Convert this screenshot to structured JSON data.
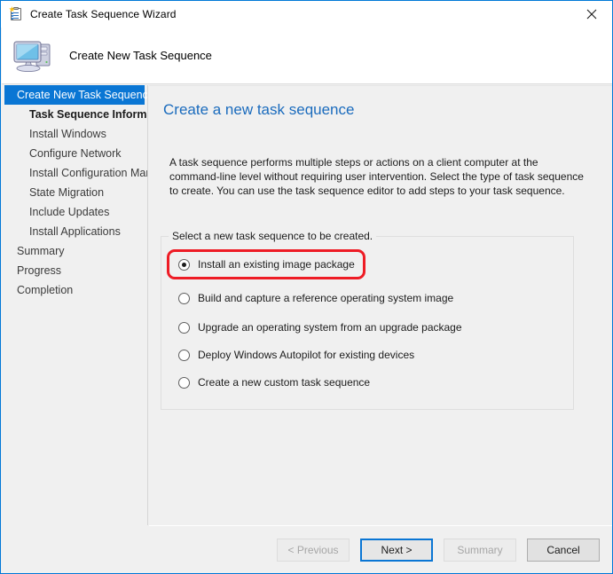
{
  "window": {
    "title": "Create Task Sequence Wizard",
    "title_icon": "task-sequence-clipboard-icon",
    "close_label": "✕",
    "accent_color": "#0078d7"
  },
  "banner": {
    "title": "Create New Task Sequence",
    "icon": "computer-monitor-icon"
  },
  "sidebar": {
    "items": [
      {
        "label": "Create New Task Sequence",
        "level": 0,
        "state": "active"
      },
      {
        "label": "Task Sequence Information",
        "level": 1,
        "state": "current"
      },
      {
        "label": "Install Windows",
        "level": 1,
        "state": "normal"
      },
      {
        "label": "Configure Network",
        "level": 1,
        "state": "normal"
      },
      {
        "label": "Install Configuration Manager",
        "level": 1,
        "state": "normal"
      },
      {
        "label": "State Migration",
        "level": 1,
        "state": "normal"
      },
      {
        "label": "Include Updates",
        "level": 1,
        "state": "normal"
      },
      {
        "label": "Install Applications",
        "level": 1,
        "state": "normal"
      },
      {
        "label": "Summary",
        "level": 0,
        "state": "normal"
      },
      {
        "label": "Progress",
        "level": 0,
        "state": "normal"
      },
      {
        "label": "Completion",
        "level": 0,
        "state": "normal"
      }
    ],
    "scrollbar": {
      "left_arrow": "❮",
      "right_arrow": "❯"
    }
  },
  "content": {
    "heading": "Create a new task sequence",
    "description": "A task sequence performs multiple steps or actions on a client computer at the command-line level without requiring user intervention. Select the type of task sequence to create. You can use the task sequence editor to add steps to your task sequence.",
    "group_label": "Select a new task sequence to be created.",
    "options": [
      {
        "label": "Install an existing image package",
        "selected": true,
        "highlighted": true
      },
      {
        "label": "Build and capture a reference operating system image",
        "selected": false,
        "highlighted": false
      },
      {
        "label": "Upgrade an operating system from an upgrade package",
        "selected": false,
        "highlighted": false
      },
      {
        "label": "Deploy Windows Autopilot for existing devices",
        "selected": false,
        "highlighted": false
      },
      {
        "label": "Create a new custom task sequence",
        "selected": false,
        "highlighted": false
      }
    ],
    "highlight_color": "#ee1c25"
  },
  "footer": {
    "buttons": [
      {
        "label": "< Previous",
        "state": "disabled"
      },
      {
        "label": "Next >",
        "state": "default"
      },
      {
        "label": "Summary",
        "state": "disabled"
      },
      {
        "label": "Cancel",
        "state": "normal"
      }
    ]
  }
}
